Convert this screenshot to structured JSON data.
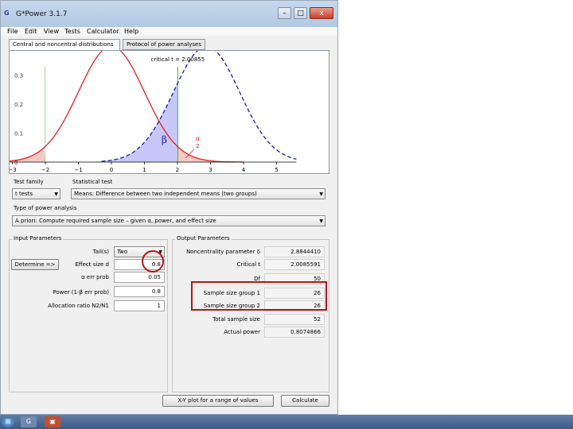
{
  "window": {
    "title": "G*Power 3.1.7",
    "app_icon_text": "G",
    "min_label": "–",
    "max_label": "□",
    "close_label": "x"
  },
  "menu": [
    "File",
    "Edit",
    "View",
    "Tests",
    "Calculator",
    "Help"
  ],
  "tabs": {
    "distributions": "Central and noncentral distributions",
    "protocol": "Protocol of power analyses"
  },
  "plot": {
    "critical_label": "critical t = 2.00855",
    "beta_label": "β",
    "alpha_label": "α",
    "alpha_sub": "2",
    "y_ticks": [
      "0.3",
      "0.2",
      "0.1",
      "0"
    ],
    "x_ticks": [
      "−3",
      "−2",
      "−1",
      "0",
      "1",
      "2",
      "3",
      "4",
      "5"
    ],
    "colors": {
      "central": "#e02020",
      "noncentral": "#1a1ab0",
      "critical_line": "#22cc22",
      "alpha_fill": "#f8c8c8",
      "beta_fill": "#c8c8f8"
    }
  },
  "test_family": {
    "label": "Test family",
    "value": "t tests"
  },
  "statistical_test": {
    "label": "Statistical test",
    "value": "Means: Difference between two independent means (two groups)"
  },
  "power_analysis": {
    "label": "Type of power analysis",
    "value": "A priori: Compute required sample size – given α, power, and effect size"
  },
  "input": {
    "group_label": "Input Parameters",
    "determine_label": "Determine =>",
    "rows": [
      {
        "label": "Tail(s)",
        "value": "Two"
      },
      {
        "label": "Effect size d",
        "value": "0.8"
      },
      {
        "label": "α err prob",
        "value": "0.05"
      },
      {
        "label": "Power (1-β err prob)",
        "value": "0.8"
      },
      {
        "label": "Allocation ratio N2/N1",
        "value": "1"
      }
    ]
  },
  "output": {
    "group_label": "Output Parameters",
    "rows": [
      {
        "label": "Noncentrality parameter δ",
        "value": "2.8844410"
      },
      {
        "label": "Critical t",
        "value": "2.0085591"
      },
      {
        "label": "Df",
        "value": "50"
      },
      {
        "label": "Sample size group 1",
        "value": "26"
      },
      {
        "label": "Sample size group 2",
        "value": "26"
      },
      {
        "label": "Total sample size",
        "value": "52"
      },
      {
        "label": "Actual power",
        "value": "0.8074866"
      }
    ]
  },
  "buttons": {
    "xy_plot": "X-Y plot for a range of values",
    "calculate": "Calculate"
  },
  "taskbar": {
    "start_label": "⊞",
    "gpower_label": "G",
    "app2_label": "▣"
  }
}
